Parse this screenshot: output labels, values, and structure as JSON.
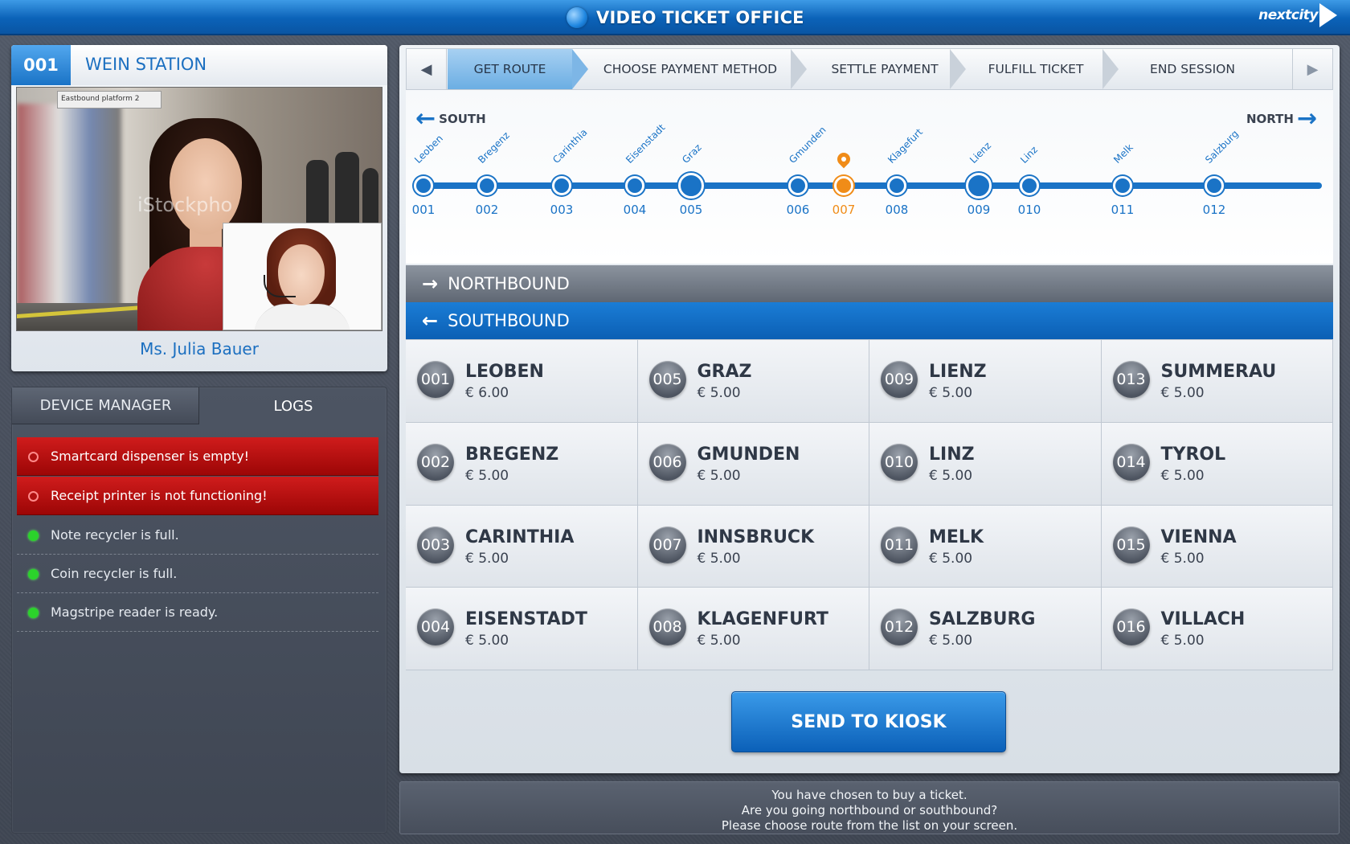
{
  "header": {
    "title": "VIDEO TICKET OFFICE",
    "logo_text": "nextcity"
  },
  "caller": {
    "station_number": "001",
    "station_name": "WEIN STATION",
    "caller_name": "Ms. Julia Bauer",
    "video_sign": "Eastbound platform 2",
    "watermark": "iStockpho"
  },
  "device_panel": {
    "tabs": [
      {
        "label": "DEVICE MANAGER"
      },
      {
        "label": "LOGS"
      }
    ],
    "logs": [
      {
        "text": "Smartcard dispenser is empty!",
        "status": "error"
      },
      {
        "text": "Receipt printer is not functioning!",
        "status": "error"
      },
      {
        "text": "Note recycler is full.",
        "status": "ok"
      },
      {
        "text": "Coin recycler is full.",
        "status": "ok"
      },
      {
        "text": "Magstripe reader is ready.",
        "status": "ok"
      }
    ]
  },
  "steps": {
    "items": [
      {
        "label": "GET ROUTE",
        "active": true
      },
      {
        "label": "CHOOSE PAYMENT METHOD",
        "active": false
      },
      {
        "label": "SETTLE PAYMENT",
        "active": false
      },
      {
        "label": "FULFILL TICKET",
        "active": false
      },
      {
        "label": "END SESSION",
        "active": false
      }
    ]
  },
  "route_map": {
    "south_label": "SOUTH",
    "north_label": "NORTH",
    "current_stop": "007",
    "stops": [
      {
        "num": "001",
        "name": "Leoben"
      },
      {
        "num": "002",
        "name": "Bregenz"
      },
      {
        "num": "003",
        "name": "Carinthia"
      },
      {
        "num": "004",
        "name": "Eisenstadt"
      },
      {
        "num": "005",
        "name": "Graz"
      },
      {
        "num": "006",
        "name": "Gmunden"
      },
      {
        "num": "007",
        "name": ""
      },
      {
        "num": "008",
        "name": "Klagefurt"
      },
      {
        "num": "009",
        "name": "Lienz"
      },
      {
        "num": "010",
        "name": "Linz"
      },
      {
        "num": "011",
        "name": "Melk"
      },
      {
        "num": "012",
        "name": "Salzburg"
      }
    ]
  },
  "directions": {
    "northbound": "NORTHBOUND",
    "southbound": "SOUTHBOUND"
  },
  "destinations": [
    {
      "num": "001",
      "name": "LEOBEN",
      "price": "€ 6.00"
    },
    {
      "num": "005",
      "name": "GRAZ",
      "price": "€ 5.00"
    },
    {
      "num": "009",
      "name": "LIENZ",
      "price": "€ 5.00"
    },
    {
      "num": "013",
      "name": "SUMMERAU",
      "price": "€ 5.00"
    },
    {
      "num": "002",
      "name": "BREGENZ",
      "price": "€ 5.00"
    },
    {
      "num": "006",
      "name": "GMUNDEN",
      "price": "€ 5.00"
    },
    {
      "num": "010",
      "name": "LINZ",
      "price": "€ 5.00"
    },
    {
      "num": "014",
      "name": "TYROL",
      "price": "€ 5.00"
    },
    {
      "num": "003",
      "name": "CARINTHIA",
      "price": "€ 5.00"
    },
    {
      "num": "007",
      "name": "INNSBRUCK",
      "price": "€ 5.00"
    },
    {
      "num": "011",
      "name": "MELK",
      "price": "€ 5.00"
    },
    {
      "num": "015",
      "name": "VIENNA",
      "price": "€ 5.00"
    },
    {
      "num": "004",
      "name": "EISENSTADT",
      "price": "€ 5.00"
    },
    {
      "num": "008",
      "name": "KLAGENFURT",
      "price": "€ 5.00"
    },
    {
      "num": "012",
      "name": "SALZBURG",
      "price": "€ 5.00"
    },
    {
      "num": "016",
      "name": "VILLACH",
      "price": "€ 5.00"
    }
  ],
  "send_button": "SEND TO KIOSK",
  "message": {
    "line1": "You have chosen to buy a ticket.",
    "line2": "Are you going northbound or southbound?",
    "line3": "Please choose route from the list on your screen."
  },
  "colors": {
    "accent_blue": "#1a73c6",
    "current_orange": "#f08c18",
    "error_red": "#c01010",
    "ok_green": "#2bd32b"
  }
}
